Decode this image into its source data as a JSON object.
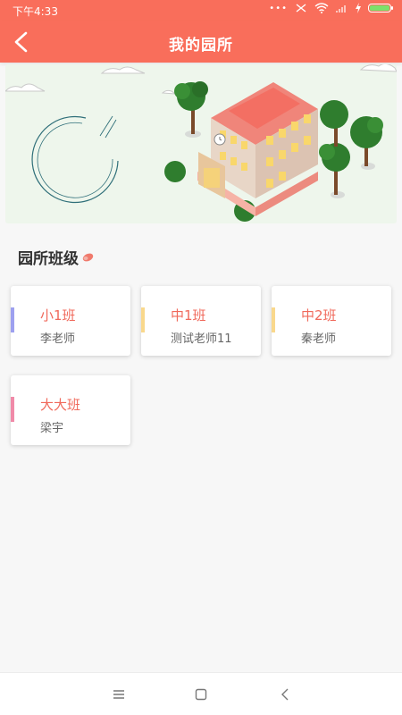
{
  "status_bar": {
    "time": "下午4:33",
    "battery_color": "#7ee06b"
  },
  "header": {
    "title": "我的园所",
    "back_icon": "chevron-left-icon"
  },
  "section": {
    "title": "园所班级"
  },
  "classes": [
    {
      "name": "小1班",
      "teacher": "李老师",
      "color": "#9da0ef"
    },
    {
      "name": "中1班",
      "teacher": "测试老师11",
      "color": "#f9d88c"
    },
    {
      "name": "中2班",
      "teacher": "秦老师",
      "color": "#f9d88c"
    },
    {
      "name": "大大班",
      "teacher": "梁宇",
      "color": "#f08aa8"
    }
  ],
  "nav": {
    "menu_icon": "menu-icon",
    "home_icon": "square-icon",
    "back_icon": "back-icon"
  },
  "colors": {
    "primary": "#f96e5b",
    "class_name": "#f0695b"
  }
}
